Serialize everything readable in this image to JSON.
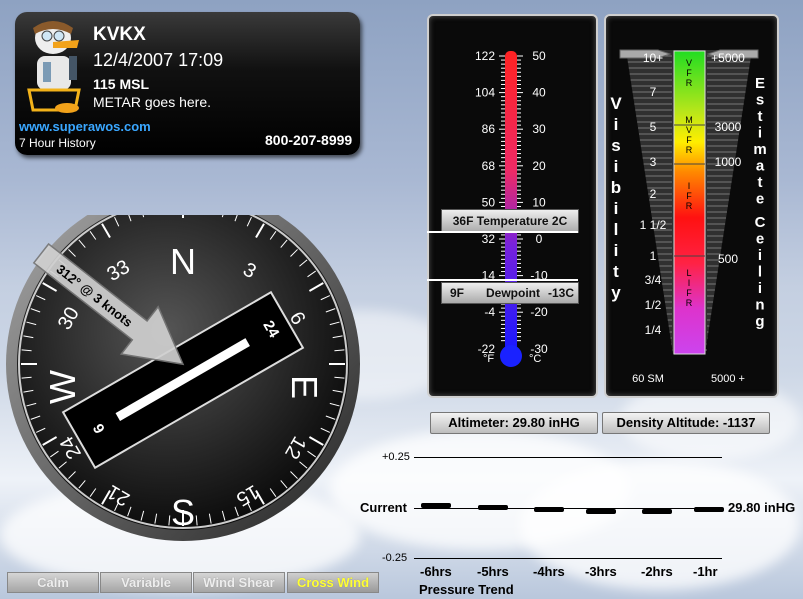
{
  "station": {
    "id": "KVKX",
    "datetime": "12/4/2007 17:09",
    "elevation": "115 MSL",
    "metar": "METAR goes here.",
    "website": "www.superawos.com",
    "history": "7 Hour History",
    "phone": "800-207-8999"
  },
  "wind": {
    "label": "312° @ 3 knots",
    "direction_deg": 312,
    "speed_kt": 3,
    "compass": {
      "n": "N",
      "s": "S",
      "e": "E",
      "w": "W",
      "t3": "3",
      "t6": "6",
      "t12": "12",
      "t15": "15",
      "t21": "21",
      "t24": "24",
      "t30": "30",
      "t33": "33"
    },
    "runway": {
      "end_a": "24",
      "end_b": "6"
    }
  },
  "wind_buttons": {
    "calm": "Calm",
    "variable": "Variable",
    "shear": "Wind Shear",
    "cross": "Cross Wind"
  },
  "thermometer": {
    "f_labels": [
      "122",
      "104",
      "86",
      "68",
      "50",
      "32",
      "14",
      "-4",
      "-22"
    ],
    "c_labels": [
      "50",
      "40",
      "30",
      "20",
      "10",
      "0",
      "-10",
      "-20",
      "-30"
    ],
    "temperature": "36F  Temperature  2C",
    "dewpoint_f": "9F",
    "dewpoint_label": "Dewpoint",
    "dewpoint_c": "-13C",
    "unit_f": "°F",
    "unit_c": "°C"
  },
  "visibility": {
    "title_letters": [
      "V",
      "i",
      "s",
      "i",
      "b",
      "i",
      "l",
      "i",
      "t",
      "y"
    ],
    "labels": [
      "10+",
      "7",
      "5",
      "3",
      "2",
      "1 1/2",
      "1",
      "3/4",
      "1/2",
      "1/4"
    ],
    "bottom": "60 SM"
  },
  "ceiling": {
    "title_letters_1": [
      "E",
      "s",
      "t",
      "i",
      "m",
      "a",
      "t",
      "e"
    ],
    "title_letters_2": [
      "C",
      "e",
      "i",
      "l",
      "i",
      "n",
      "g"
    ],
    "labels": [
      "+5000",
      "3000",
      "1000",
      "500"
    ],
    "bottom": "5000 +"
  },
  "flight_categories": {
    "vfr": [
      "V",
      "F",
      "R"
    ],
    "mvfr": [
      "M",
      "V",
      "F",
      "R"
    ],
    "ifr": [
      "I",
      "F",
      "R"
    ],
    "lifr": [
      "L",
      "I",
      "F",
      "R"
    ]
  },
  "altimeter": "Altimeter: 29.80 inHG",
  "density_altitude": "Density Altitude: -1137",
  "pressure": {
    "top": "+0.25",
    "bottom": "-0.25",
    "current_label": "Current",
    "current_value": "29.80 inHG",
    "hours": [
      "-6hrs",
      "-5hrs",
      "-4hrs",
      "-3hrs",
      "-2hrs",
      "-1hr"
    ],
    "title": "Pressure Trend"
  }
}
